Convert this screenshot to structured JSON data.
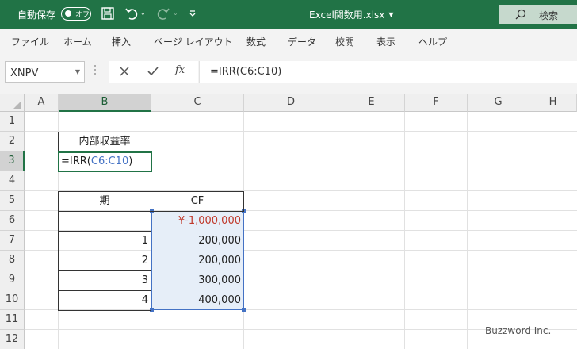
{
  "titlebar": {
    "autosave_label": "自動保存",
    "autosave_state": "オフ",
    "filename": "Excel関数用.xlsx",
    "search_label": "検索"
  },
  "ribbon": {
    "tabs": [
      "ファイル",
      "ホーム",
      "挿入",
      "ページ レイアウト",
      "数式",
      "データ",
      "校閲",
      "表示",
      "ヘルプ"
    ]
  },
  "formula_bar": {
    "name_box": "XNPV",
    "formula": "=IRR(C6:C10)",
    "fx_label": "fx"
  },
  "columns": [
    "A",
    "B",
    "C",
    "D",
    "E",
    "F",
    "G",
    "H"
  ],
  "rows": [
    "1",
    "2",
    "3",
    "4",
    "5",
    "6",
    "7",
    "8",
    "9",
    "10",
    "11",
    "12"
  ],
  "cells": {
    "B2": "内部収益率",
    "B3_prefix": "=IRR(",
    "B3_ref": "C6:C10",
    "B3_suffix": ")",
    "B5": "期",
    "C5": "CF",
    "C6": "¥-1,000,000",
    "B7": "1",
    "C7": "200,000",
    "B8": "2",
    "C8": "200,000",
    "B9": "3",
    "C9": "300,000",
    "B10": "4",
    "C10": "400,000"
  },
  "watermark": "Buzzword Inc.",
  "colors": {
    "excel_green": "#217346",
    "negative": "#c0392b",
    "range_ref": "#4472c4",
    "range_fill": "#e6eef8"
  }
}
